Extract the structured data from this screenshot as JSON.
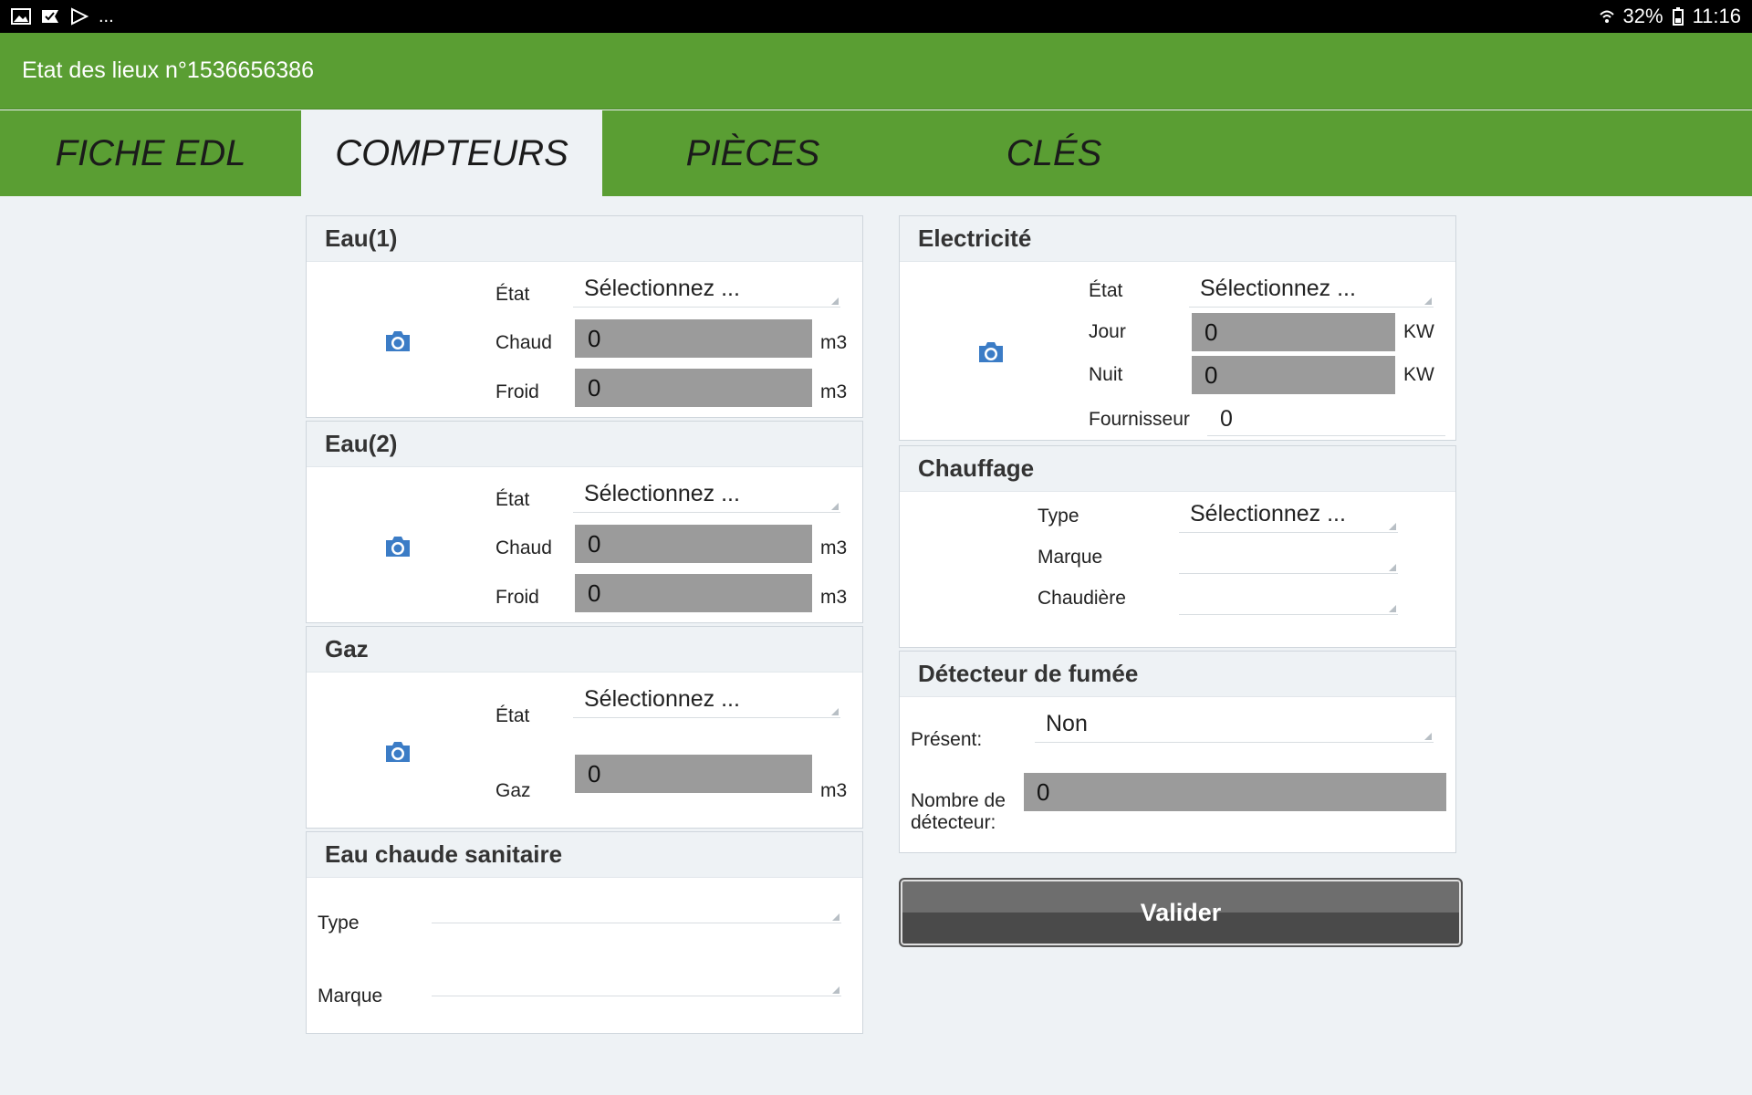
{
  "status_bar": {
    "left_icons": [
      "image-icon",
      "check-flag-icon",
      "play-store-icon"
    ],
    "more": "...",
    "battery": "32%",
    "time": "11:16"
  },
  "app_bar": {
    "title": "Etat des lieux n°1536656386"
  },
  "tabs": [
    {
      "label": "FICHE EDL",
      "active": false
    },
    {
      "label": "COMPTEURS",
      "active": true
    },
    {
      "label": "PIÈCES",
      "active": false
    },
    {
      "label": "CLÉS",
      "active": false
    }
  ],
  "eau1": {
    "title": "Eau(1)",
    "etat_label": "État",
    "etat_value": "Sélectionnez ...",
    "chaud_label": "Chaud",
    "chaud_value": "0",
    "chaud_unit": "m3",
    "froid_label": "Froid",
    "froid_value": "0",
    "froid_unit": "m3"
  },
  "eau2": {
    "title": "Eau(2)",
    "etat_label": "État",
    "etat_value": "Sélectionnez ...",
    "chaud_label": "Chaud",
    "chaud_value": "0",
    "chaud_unit": "m3",
    "froid_label": "Froid",
    "froid_value": "0",
    "froid_unit": "m3"
  },
  "gaz": {
    "title": "Gaz",
    "etat_label": "État",
    "etat_value": "Sélectionnez ...",
    "gaz_label": "Gaz",
    "gaz_value": "0",
    "gaz_unit": "m3"
  },
  "ecs": {
    "title": "Eau chaude sanitaire",
    "type_label": "Type",
    "type_value": "",
    "marque_label": "Marque",
    "marque_value": ""
  },
  "electricite": {
    "title": "Electricité",
    "etat_label": "État",
    "etat_value": "Sélectionnez ...",
    "jour_label": "Jour",
    "jour_value": "0",
    "jour_unit": "KW",
    "nuit_label": "Nuit",
    "nuit_value": "0",
    "nuit_unit": "KW",
    "fournisseur_label": "Fournisseur",
    "fournisseur_value": "0"
  },
  "chauffage": {
    "title": "Chauffage",
    "type_label": "Type",
    "type_value": "Sélectionnez ...",
    "marque_label": "Marque",
    "marque_value": "",
    "chaudiere_label": "Chaudière",
    "chaudiere_value": ""
  },
  "detecteur": {
    "title": "Détecteur de fumée",
    "present_label": "Présent:",
    "present_value": "Non",
    "nombre_label_1": "Nombre de",
    "nombre_label_2": "détecteur:",
    "nombre_value": "0"
  },
  "valider_label": "Valider",
  "colors": {
    "green": "#5a9e33",
    "field_gray": "#9b9b9b",
    "camera_blue": "#3b7cc6"
  }
}
